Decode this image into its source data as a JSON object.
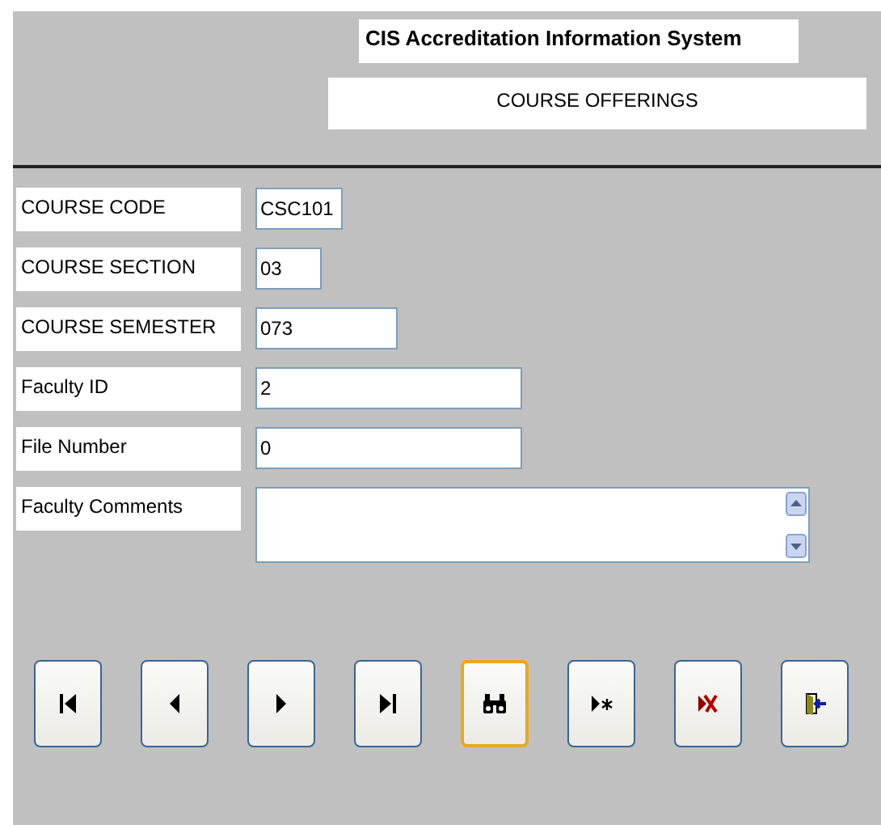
{
  "header": {
    "title": "CIS Accreditation Information System",
    "subtitle": "COURSE OFFERINGS"
  },
  "fields": [
    {
      "label": "COURSE CODE",
      "value": "CSC101",
      "kind": "short"
    },
    {
      "label": "COURSE SECTION",
      "value": "03",
      "kind": "tiny"
    },
    {
      "label": "COURSE SEMESTER",
      "value": "073",
      "kind": "medium"
    },
    {
      "label": "Faculty ID",
      "value": "2",
      "kind": "long"
    },
    {
      "label": "File Number",
      "value": "0",
      "kind": "long"
    },
    {
      "label": "Faculty Comments",
      "kind": "memo"
    }
  ],
  "buttons": [
    {
      "kind": "first",
      "focused": false
    },
    {
      "kind": "previous",
      "focused": false
    },
    {
      "kind": "next",
      "focused": false
    },
    {
      "kind": "last",
      "focused": false
    },
    {
      "kind": "find",
      "focused": true
    },
    {
      "kind": "new",
      "focused": false
    },
    {
      "kind": "delete",
      "focused": false
    },
    {
      "kind": "exit",
      "focused": false
    }
  ]
}
